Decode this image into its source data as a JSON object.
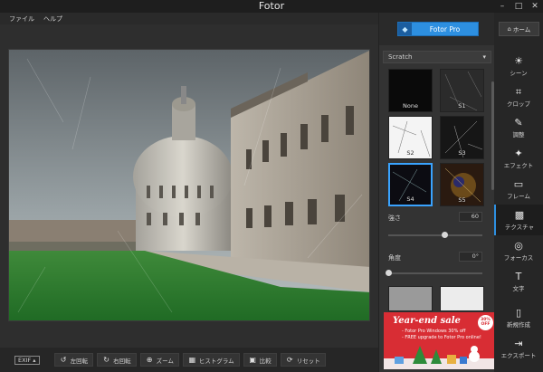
{
  "window": {
    "title": "Fotor",
    "minimize": "–",
    "maximize": "□",
    "close": "✕"
  },
  "menu": [
    "ファイル",
    "ヘルプ"
  ],
  "toolbar": {
    "exif": "EXIF",
    "items": [
      {
        "icon": "rotate-left-icon",
        "label": "左回転"
      },
      {
        "icon": "rotate-right-icon",
        "label": "右回転"
      },
      {
        "icon": "zoom-icon",
        "label": "ズーム"
      },
      {
        "icon": "histogram-icon",
        "label": "ヒストグラム"
      },
      {
        "icon": "compare-icon",
        "label": "比較"
      },
      {
        "icon": "reset-icon",
        "label": "リセット"
      }
    ]
  },
  "panel": {
    "pro_label": "Fotor Pro",
    "section": "Scratch",
    "thumbnails": [
      {
        "label": "None",
        "selected": false
      },
      {
        "label": "S1",
        "selected": false
      },
      {
        "label": "S2",
        "selected": false
      },
      {
        "label": "S3",
        "selected": false
      },
      {
        "label": "S4",
        "selected": true
      },
      {
        "label": "S5",
        "selected": false
      }
    ],
    "strength_label": "強さ",
    "strength_value": "60",
    "strength_fraction": 0.6,
    "angle_label": "角度",
    "angle_value": "0°",
    "angle_fraction": 0.0
  },
  "sale": {
    "title": "Year-end sale",
    "line1": "- Fotor Pro Windows 30% off",
    "line2": "- FREE upgrade to Fotor Pro online!",
    "badge": "30% OFF"
  },
  "nav": {
    "home": "ホーム",
    "items": [
      {
        "icon": "scene-icon",
        "label": "シーン",
        "active": false
      },
      {
        "icon": "crop-icon",
        "label": "クロップ",
        "active": false
      },
      {
        "icon": "adjust-icon",
        "label": "調整",
        "active": false
      },
      {
        "icon": "effect-icon",
        "label": "エフェクト",
        "active": false
      },
      {
        "icon": "frame-icon",
        "label": "フレーム",
        "active": false
      },
      {
        "icon": "texture-icon",
        "label": "テクスチャ",
        "active": true
      },
      {
        "icon": "focus-icon",
        "label": "フォーカス",
        "active": false
      },
      {
        "icon": "text-icon",
        "label": "文字",
        "active": false
      },
      {
        "icon": "new-icon",
        "label": "新規作成",
        "active": false
      },
      {
        "icon": "export-icon",
        "label": "エクスポート",
        "active": false
      }
    ]
  }
}
